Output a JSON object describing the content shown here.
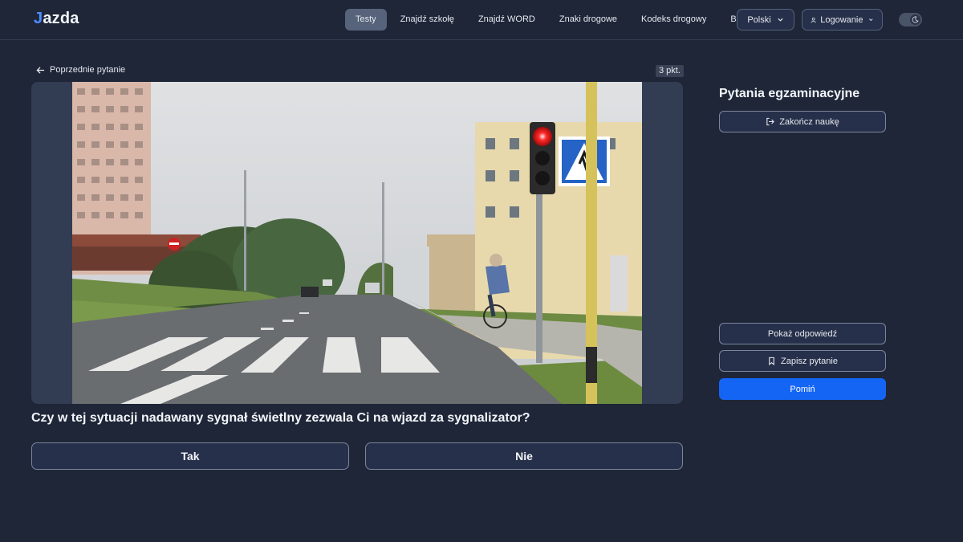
{
  "header": {
    "logo_text": "jazda",
    "nav": [
      {
        "label": "Testy",
        "active": true
      },
      {
        "label": "Znajdź szkołę"
      },
      {
        "label": "Znajdź WORD"
      },
      {
        "label": "Znaki drogowe"
      },
      {
        "label": "Kodeks drogowy"
      },
      {
        "label": "Blog"
      }
    ],
    "language": "Polski",
    "login": "Logowanie",
    "theme_toggle_icon": "moon-icon"
  },
  "main": {
    "prev_question": "Poprzednie pytanie",
    "points": "3 pkt.",
    "question": "Czy w tej sytuacji nadawany sygnał świetlny zezwala Ci na wjazd za sygnalizator?",
    "answers": {
      "yes": "Tak",
      "no": "Nie"
    }
  },
  "sidebar": {
    "title": "Pytania egzaminacyjne",
    "end_learning": "Zakończ naukę",
    "show_answer": "Pokaż odpowiedź",
    "save_question": "Zapisz pytanie",
    "skip": "Pomiń"
  },
  "colors": {
    "background": "#1e2638",
    "accent": "#1565f5",
    "active_nav": "#56637b",
    "traffic_light_red": "#ff2a2a"
  }
}
